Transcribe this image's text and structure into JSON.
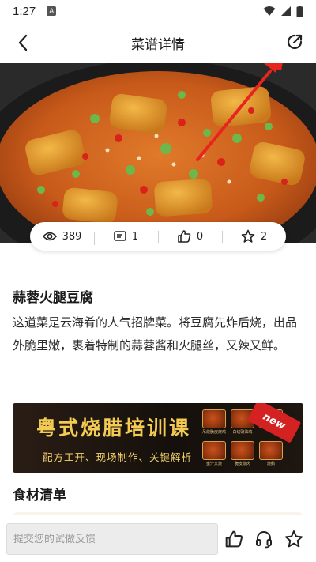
{
  "status_bar": {
    "time": "1:27",
    "notification_glyph": "A",
    "icons": [
      "wifi-icon",
      "signal-icon",
      "battery-icon"
    ]
  },
  "nav": {
    "title": "菜谱详情",
    "back_icon": "chevron-left-icon",
    "share_icon": "share-icon"
  },
  "hero": {
    "image": "braised tofu dish photo",
    "annotation": "red arrow pointing to share button"
  },
  "stats": [
    {
      "icon": "eye-icon",
      "value": "389"
    },
    {
      "icon": "comment-icon",
      "value": "1"
    },
    {
      "icon": "thumbs-up-icon",
      "value": "0"
    },
    {
      "icon": "star-icon",
      "value": "2"
    }
  ],
  "recipe": {
    "title": "蒜蓉火腿豆腐",
    "description": "这道菜是云海肴的人气招牌菜。将豆腐先炸后烧，出品外脆里嫩，裹着特制的蒜蓉酱和火腿丝，又辣又鲜。"
  },
  "banner": {
    "title": "粤式烧腊培训课",
    "subtitle": "配方工开、现场制作、关键解析",
    "badge": "new",
    "dish_labels": [
      "吊烧脆皮烧鸡",
      "白切豉油鸡",
      "",
      "蜜汁叉烧",
      "脆皮烧肉",
      "烧鹅"
    ]
  },
  "ingredients": {
    "title": "食材清单"
  },
  "bottom_bar": {
    "placeholder": "提交您的试做反馈",
    "icons": [
      "thumbs-up-icon",
      "headset-icon",
      "star-icon"
    ]
  },
  "colors": {
    "accent_red": "#e8241f",
    "banner_gold": "#f3cb52",
    "banner_bg": "#1b130d"
  }
}
